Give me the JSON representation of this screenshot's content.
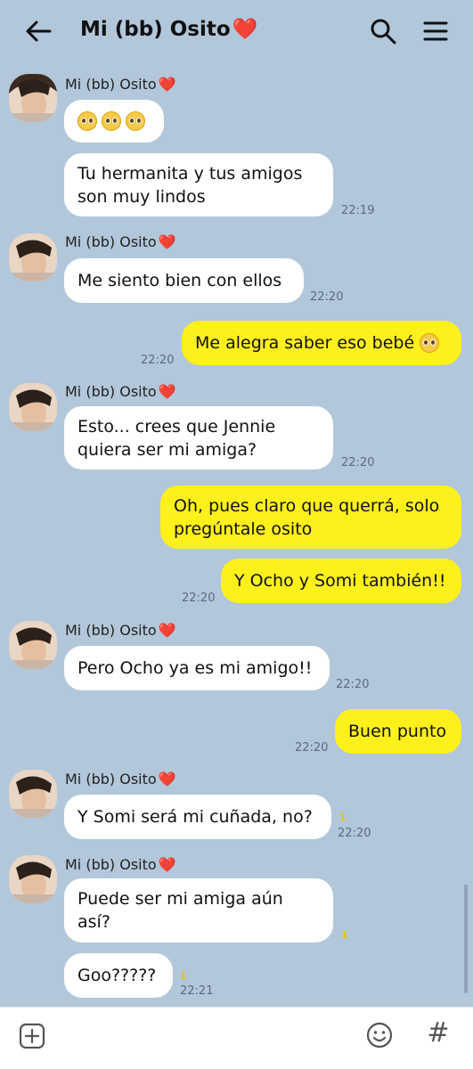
{
  "header": {
    "title": "Mi (bb) Osito",
    "title_emoji": "❤️",
    "back_icon": "arrow-left-icon",
    "search_icon": "search-icon",
    "menu_icon": "hamburger-menu-icon"
  },
  "colors": {
    "background": "#b2c7da",
    "incoming_bubble": "#ffffff",
    "outgoing_bubble": "#fef01b",
    "heart": "#e8273a"
  },
  "messages": [
    {
      "sender": "Mi (bb) Osito",
      "heart": "❤️",
      "text": "🥺🥺🥺",
      "time": ""
    },
    {
      "text": "Tu hermanita y tus amigos son muy lindos",
      "time": "22:19"
    },
    {
      "sender": "Mi (bb) Osito",
      "heart": "❤️",
      "text": "Me siento bien con ellos",
      "time": "22:20"
    },
    {
      "text": "Me alegra saber eso bebé",
      "emoji": "🥺",
      "time": "22:20"
    },
    {
      "sender": "Mi (bb) Osito",
      "heart": "❤️",
      "text": "Esto... crees que Jennie quiera ser mi amiga?",
      "time": "22:20"
    },
    {
      "text": "Oh, pues claro que querrá, solo pregúntale osito",
      "time": ""
    },
    {
      "text": "Y Ocho y Somi también!!",
      "time": "22:20"
    },
    {
      "sender": "Mi (bb) Osito",
      "heart": "❤️",
      "text": "Pero Ocho ya es mi amigo!!",
      "time": "22:20"
    },
    {
      "text": "Buen punto",
      "time": "22:20"
    },
    {
      "sender": "Mi (bb) Osito",
      "heart": "❤️",
      "text": "Y Somi será mi cuñada, no?",
      "unread": "1",
      "time": "22:20"
    },
    {
      "sender": "Mi (bb) Osito",
      "heart": "❤️",
      "text": "Puede ser mi amiga aún así?",
      "unread": "1",
      "time": ""
    },
    {
      "text": "Goo?????",
      "unread": "1",
      "time": "22:21"
    }
  ],
  "inputbar": {
    "placeholder": "",
    "plus_icon": "plus-square-icon",
    "emoji_icon": "smiley-icon",
    "hashtag_icon": "hashtag-icon",
    "hashtag_glyph": "#"
  }
}
